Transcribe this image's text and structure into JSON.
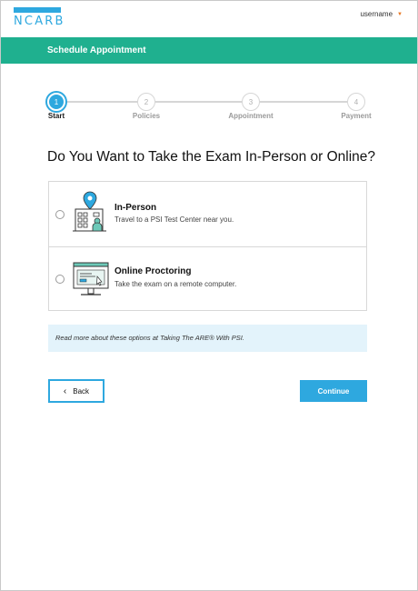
{
  "header": {
    "logo_text": "NCARB",
    "username": "username"
  },
  "banner": {
    "title": "Schedule Appointment"
  },
  "stepper": {
    "steps": [
      {
        "number": "1",
        "label": "Start",
        "active": true
      },
      {
        "number": "2",
        "label": "Policies",
        "active": false
      },
      {
        "number": "3",
        "label": "Appointment",
        "active": false
      },
      {
        "number": "4",
        "label": "Payment",
        "active": false
      }
    ]
  },
  "question": "Do You Want to Take the Exam In-Person or Online?",
  "options": [
    {
      "title": "In-Person",
      "description": "Travel to a PSI Test Center near you.",
      "icon": "test-center-location-icon",
      "selected": false
    },
    {
      "title": "Online Proctoring",
      "description": "Take the exam on a remote computer.",
      "icon": "computer-monitor-icon",
      "selected": false
    }
  ],
  "info_text": "Read more about these options at Taking The ARE® With PSI.",
  "buttons": {
    "back": "Back",
    "continue": "Continue"
  },
  "colors": {
    "brand_blue": "#2ea8df",
    "banner_green": "#1fb08f",
    "accent_orange": "#e87722",
    "info_bg": "#e3f3fb"
  }
}
